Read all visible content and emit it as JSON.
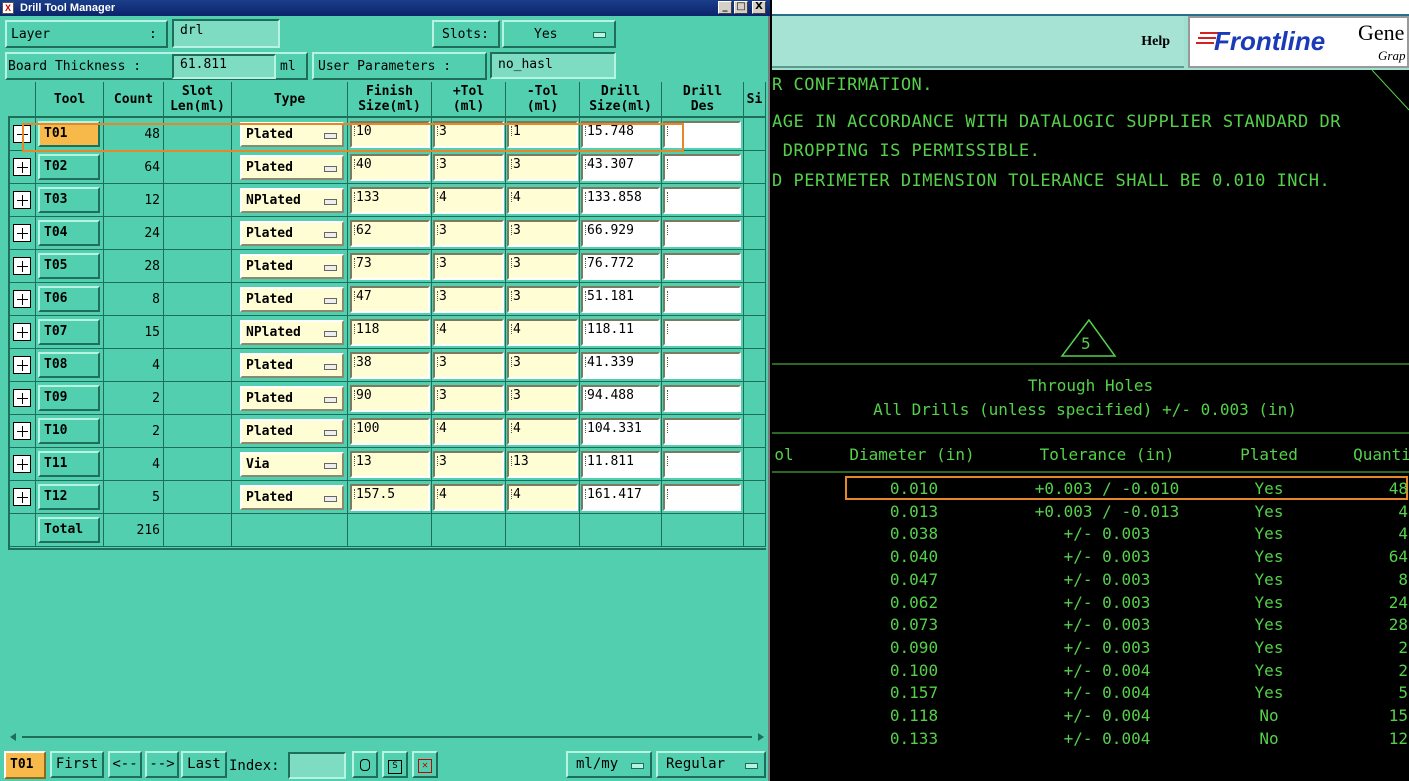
{
  "window": {
    "title": "Drill Tool Manager",
    "controls": [
      "_",
      "□",
      "X"
    ]
  },
  "form": {
    "layer_label": "Layer",
    "layer_colon": ":",
    "layer_value": "drl",
    "slots_label": "Slots:",
    "slots_value": "Yes",
    "board_thickness_label": "Board Thickness  :",
    "board_thickness_value": "61.811",
    "board_thickness_unit": "ml",
    "user_params_label": "User Parameters  :",
    "user_params_value": "no_hasl"
  },
  "table": {
    "headers": [
      "Tool",
      "Count",
      "Slot\nLen(ml)",
      "Type",
      "Finish\nSize(ml)",
      "+Tol\n(ml)",
      "-Tol\n(ml)",
      "Drill\nSize(ml)",
      "Drill\nDes",
      "Si"
    ],
    "rows": [
      {
        "tool": "T01",
        "count": "48",
        "type": "Plated",
        "finish": "10",
        "ptol": "3",
        "ntol": "1",
        "drill": "15.748",
        "des": ""
      },
      {
        "tool": "T02",
        "count": "64",
        "type": "Plated",
        "finish": "40",
        "ptol": "3",
        "ntol": "3",
        "drill": "43.307",
        "des": ""
      },
      {
        "tool": "T03",
        "count": "12",
        "type": "NPlated",
        "finish": "133",
        "ptol": "4",
        "ntol": "4",
        "drill": "133.858",
        "des": ""
      },
      {
        "tool": "T04",
        "count": "24",
        "type": "Plated",
        "finish": "62",
        "ptol": "3",
        "ntol": "3",
        "drill": "66.929",
        "des": ""
      },
      {
        "tool": "T05",
        "count": "28",
        "type": "Plated",
        "finish": "73",
        "ptol": "3",
        "ntol": "3",
        "drill": "76.772",
        "des": ""
      },
      {
        "tool": "T06",
        "count": "8",
        "type": "Plated",
        "finish": "47",
        "ptol": "3",
        "ntol": "3",
        "drill": "51.181",
        "des": ""
      },
      {
        "tool": "T07",
        "count": "15",
        "type": "NPlated",
        "finish": "118",
        "ptol": "4",
        "ntol": "4",
        "drill": "118.11",
        "des": ""
      },
      {
        "tool": "T08",
        "count": "4",
        "type": "Plated",
        "finish": "38",
        "ptol": "3",
        "ntol": "3",
        "drill": "41.339",
        "des": ""
      },
      {
        "tool": "T09",
        "count": "2",
        "type": "Plated",
        "finish": "90",
        "ptol": "3",
        "ntol": "3",
        "drill": "94.488",
        "des": ""
      },
      {
        "tool": "T10",
        "count": "2",
        "type": "Plated",
        "finish": "100",
        "ptol": "4",
        "ntol": "4",
        "drill": "104.331",
        "des": ""
      },
      {
        "tool": "T11",
        "count": "4",
        "type": "Via",
        "finish": "13",
        "ptol": "3",
        "ntol": "13",
        "drill": "11.811",
        "des": ""
      },
      {
        "tool": "T12",
        "count": "5",
        "type": "Plated",
        "finish": "157.5",
        "ptol": "4",
        "ntol": "4",
        "drill": "161.417",
        "des": ""
      }
    ],
    "total_label": "Total",
    "total_count": "216",
    "selected_tool": "T01"
  },
  "bottom": {
    "current_tool": "T01",
    "first": "First",
    "prev": "<--",
    "next": "-->",
    "last": "Last",
    "index_label": "Index:",
    "units": "ml/my",
    "mode": "Regular"
  },
  "right": {
    "help": "Help",
    "logo_text": "Frontline",
    "logo_side": "Gene",
    "logo_sub": "Grap",
    "notes": [
      "R CONFIRMATION.",
      "AGE IN ACCORDANCE WITH DATALOGIC SUPPLIER STANDARD DR",
      " DROPPING IS PERMISSIBLE.",
      "D PERIMETER DIMENSION TOLERANCE SHALL BE 0.010 INCH."
    ],
    "triangle_label": "5",
    "drill_title": "Through Holes",
    "drill_subtitle": "All Drills (unless specified) +/- 0.003 (in)",
    "drill_headers": [
      "ol",
      "Diameter (in)",
      "Tolerance (in)",
      "Plated",
      "Quanti"
    ],
    "drill_rows": [
      {
        "dia": "0.010",
        "tol": "+0.003 / -0.010",
        "plated": "Yes",
        "qty": "48"
      },
      {
        "dia": "0.013",
        "tol": "+0.003 / -0.013",
        "plated": "Yes",
        "qty": "4"
      },
      {
        "dia": "0.038",
        "tol": "+/- 0.003",
        "plated": "Yes",
        "qty": "4"
      },
      {
        "dia": "0.040",
        "tol": "+/- 0.003",
        "plated": "Yes",
        "qty": "64"
      },
      {
        "dia": "0.047",
        "tol": "+/- 0.003",
        "plated": "Yes",
        "qty": "8"
      },
      {
        "dia": "0.062",
        "tol": "+/- 0.003",
        "plated": "Yes",
        "qty": "24"
      },
      {
        "dia": "0.073",
        "tol": "+/- 0.003",
        "plated": "Yes",
        "qty": "28"
      },
      {
        "dia": "0.090",
        "tol": "+/- 0.003",
        "plated": "Yes",
        "qty": "2"
      },
      {
        "dia": "0.100",
        "tol": "+/- 0.004",
        "plated": "Yes",
        "qty": "2"
      },
      {
        "dia": "0.157",
        "tol": "+/- 0.004",
        "plated": "Yes",
        "qty": "5"
      },
      {
        "dia": "0.118",
        "tol": "+/- 0.004",
        "plated": "No",
        "qty": "15"
      },
      {
        "dia": "0.133",
        "tol": "+/- 0.004",
        "plated": "No",
        "qty": "12"
      }
    ]
  },
  "colors": {
    "panel": "#52cfae",
    "input": "#fffdd4",
    "highlight": "#e8872a",
    "selected_tool": "#f6b94a",
    "cad_green": "#55d04a"
  }
}
